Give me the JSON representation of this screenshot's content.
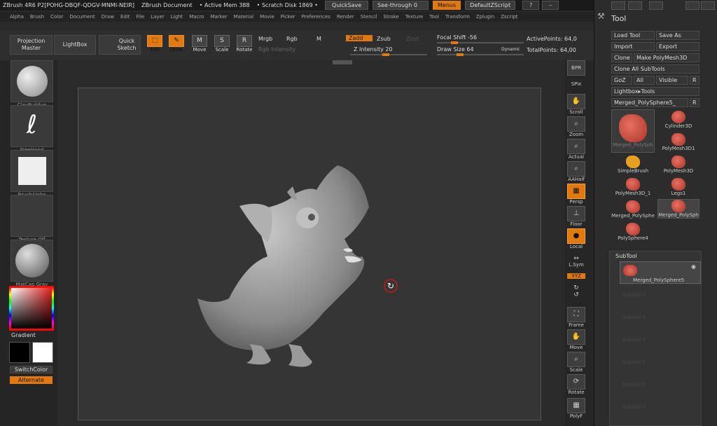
{
  "titlebar": {
    "app": "ZBrush 4R6 P2[POHG-DBQF-QDGV-MNMI-NEIR]",
    "document": "ZBrush Document",
    "mem": "• Active Mem 388",
    "disk": "• Scratch Disk 1869 •",
    "quicksave": "QuickSave",
    "seethrough": "See-through 0",
    "menus": "Menus",
    "script": "DefaultZScript"
  },
  "menubar": [
    "Alpha",
    "Brush",
    "Color",
    "Document",
    "Draw",
    "Edit",
    "File",
    "Layer",
    "Light",
    "Macro",
    "Marker",
    "Material",
    "Movie",
    "Picker",
    "Preferences",
    "Render",
    "Stencil",
    "Stroke",
    "Texture",
    "Tool",
    "Transform",
    "Zplugin",
    "Zscript"
  ],
  "toolbar": {
    "projection_master": "Projection Master",
    "lightbox": "LightBox",
    "quick_sketch": "Quick Sketch",
    "edit": "Edit",
    "draw": "Draw",
    "move": "Move",
    "scale": "Scale",
    "rotate": "Rotate",
    "mrgb": "Mrgb",
    "rgb": "Rgb",
    "m": "M",
    "rgb_intensity": "Rgb Intensity",
    "zadd": "Zadd",
    "zsub": "Zsub",
    "zcut": "Zcut",
    "z_intensity": "Z Intensity 20",
    "focal_shift": "Focal Shift -56",
    "draw_size": "Draw Size 64",
    "dynamic": "Dynamic",
    "active_points": "ActivePoints: 64,0",
    "total_points": "TotalPoints: 64,00"
  },
  "leftpanel": {
    "brush": "ClayBuildup",
    "stroke": "FreeHand",
    "alpha": "BrushAlpha",
    "texture": "Texture Off",
    "material": "MatCap Gray",
    "gradient": "Gradient",
    "switchcolor": "SwitchColor",
    "alternate": "Alternate"
  },
  "rightstrip": [
    "BPR",
    "SPix",
    "Scroll",
    "Zoom",
    "Actual",
    "AAHalf",
    "Persp",
    "Floor",
    "Local",
    "L.Sym",
    "XYZ",
    "Frame",
    "Move",
    "Scale",
    "Rotate",
    "PolyF"
  ],
  "toolpanel": {
    "title": "Tool",
    "load_tool": "Load Tool",
    "save_as": "Save As",
    "import": "Import",
    "export": "Export",
    "clone": "Clone",
    "make_polymesh": "Make PolyMesh3D",
    "clone_all": "Clone All SubTools",
    "goz": "GoZ",
    "all": "All",
    "visible": "Visible",
    "r": "R",
    "lightbox_tools": "Lightbox▸Tools",
    "current_tool": "Merged_PolySphere5_",
    "tiles": [
      {
        "label": "Merged_PolySph"
      },
      {
        "label": "Cylinder3D"
      },
      {
        "label": "PolyMesh3D1"
      },
      {
        "label": "SimpleBrush"
      },
      {
        "label": "PolyMesh3D"
      },
      {
        "label": "PolyMesh3D_1"
      },
      {
        "label": "Legs1"
      },
      {
        "label": "Merged_PolySphe"
      },
      {
        "label": "Merged_PolySph"
      },
      {
        "label": "PolySphere4"
      }
    ],
    "subtool_title": "SubTool",
    "subtool_item": "Merged_PolySphere5",
    "ghost_label": "Subtool 0"
  },
  "colors": {
    "accent": "#e07a10",
    "model": "#a6a6a6"
  }
}
